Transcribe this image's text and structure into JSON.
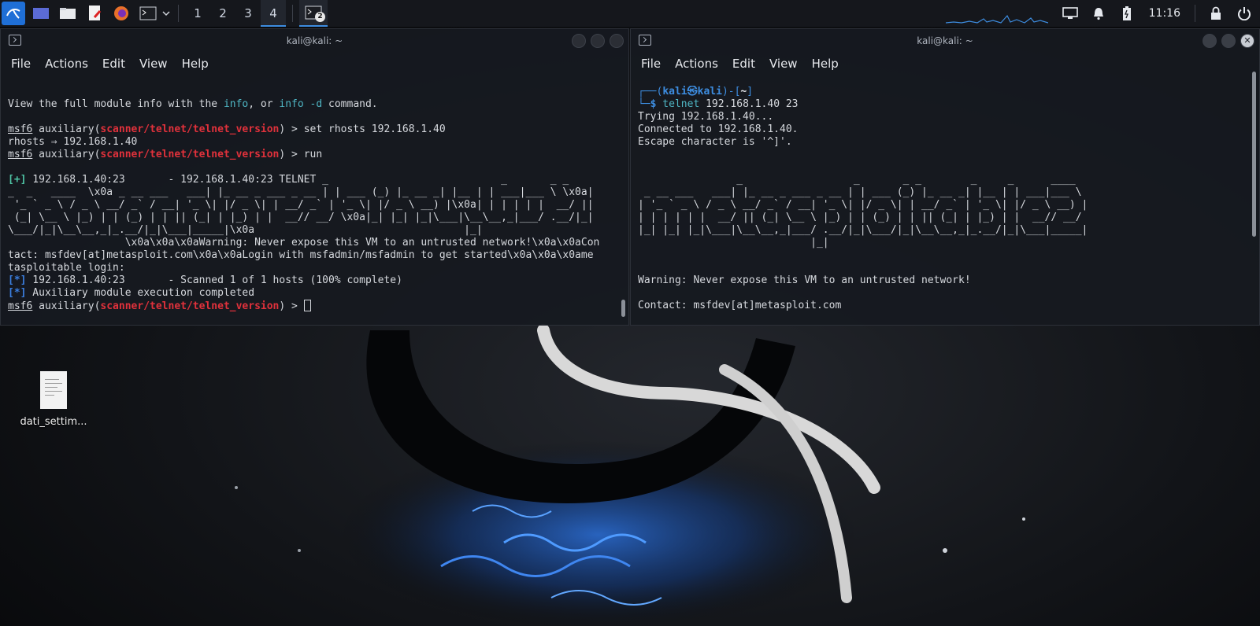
{
  "taskbar": {
    "workspaces": [
      "1",
      "2",
      "3",
      "4"
    ],
    "active_workspace": "4",
    "task_badge": "2",
    "clock": "11:16",
    "icons": [
      "kali-menu-icon",
      "desktop-icon",
      "file-manager-icon",
      "text-editor-icon",
      "firefox-icon",
      "terminal-icon",
      "dropdown-chevron-icon",
      "terminal-task-icon",
      "network-icon",
      "notifications-icon",
      "battery-icon",
      "lock-icon",
      "power-icon"
    ]
  },
  "left_window": {
    "title": "kali@kali: ~",
    "menu": [
      "File",
      "Actions",
      "Edit",
      "View",
      "Help"
    ],
    "lines": {
      "l1a": "View the full module info with the ",
      "l1b": "info",
      "l1c": ", or ",
      "l1d": "info -d",
      "l1e": " command.",
      "prompt": "msf6",
      "aux": " auxiliary(",
      "module": "scanner/telnet/telnet_version",
      "l3_cmd": ") > set rhosts 192.168.1.40",
      "l4": "rhosts ⇒ 192.168.1.40",
      "l5_cmd": ") > run",
      "plus": "[+]",
      "l7": " 192.168.1.40:23       - 192.168.1.40:23 TELNET _                            _       _ _         _",
      "l8": "_  _   ____  \\x0a _ __ ___   ___| |_ __ _ ___ _ __ | | ___ (_) |_ __ _| |__ | | ___|___ \\ \\x0a|",
      "l9": " '_ ` _ \\ / _ \\ __/ _` / __| '_ \\| |/ _ \\| | __/ _` | '_ \\| |/ _ \\ __) |\\x0a| | | | | |  __/ ||",
      "l10": " (_| \\__ \\ |_) | | (_) | | || (_| | |_) | |  __// __/ \\x0a|_| |_| |_|\\___|\\__\\__,_|___/ .__/|_|",
      "l11": "\\___/|_|\\__\\__,_|_.__/|_|\\___|_____|\\x0a                                  |_|",
      "l12": "                   \\x0a\\x0a\\x0aWarning: Never expose this VM to an untrusted network!\\x0a\\x0aCon",
      "l13": "tact: msfdev[at]metasploit.com\\x0a\\x0aLogin with msfadmin/msfadmin to get started\\x0a\\x0a\\x0ame",
      "l14": "tasploitable login:",
      "star": "[*]",
      "l15": " 192.168.1.40:23       - Scanned 1 of 1 hosts (100% complete)",
      "l16": " Auxiliary module execution completed",
      "l17_cmd": ") > "
    }
  },
  "right_window": {
    "title": "kali@kali: ~",
    "menu": [
      "File",
      "Actions",
      "Edit",
      "View",
      "Help"
    ],
    "lines": {
      "p1": "┌──(",
      "user": "kali㉿kali",
      "p2": ")-[",
      "dir": "~",
      "p3": "]",
      "p4": "└─",
      "dollar": "$",
      "cmd_name": " telnet",
      "cmd_args": " 192.168.1.40 23",
      "r3": "Trying 192.168.1.40...",
      "r4": "Connected to 192.168.1.40.",
      "r5": "Escape character is '^]'.",
      "a1": "                _                  _       _ _        _     _      ____",
      "a2": " _ __ ___   ___| |_ __ _ ___ _ __ | | ___ (_) |_ __ _| |__ | | ___|___ \\",
      "a3": "| '_ ` _ \\ / _ \\ __/ _` / __| '_ \\| |/ _ \\| | __/ _` | '_ \\| |/ _ \\ __) |",
      "a4": "| | | | | |  __/ || (_| \\__ \\ |_) | | (_) | | || (_| | |_) | |  __// __/",
      "a5": "|_| |_| |_|\\___|\\__\\__,_|___/ .__/|_|\\___/|_|\\__\\__,_|_.__/|_|\\___|_____|",
      "a6": "                            |_|",
      "w1": "Warning: Never expose this VM to an untrusted network!",
      "w2": "Contact: msfdev[at]metasploit.com"
    }
  },
  "desktop": {
    "file_label": "dati_settim..."
  },
  "colors": {
    "accent": "#3d8de0",
    "module_red": "#e0313b",
    "highlight_cyan": "#4fb6c4",
    "success_green": "#4fc4a5"
  }
}
